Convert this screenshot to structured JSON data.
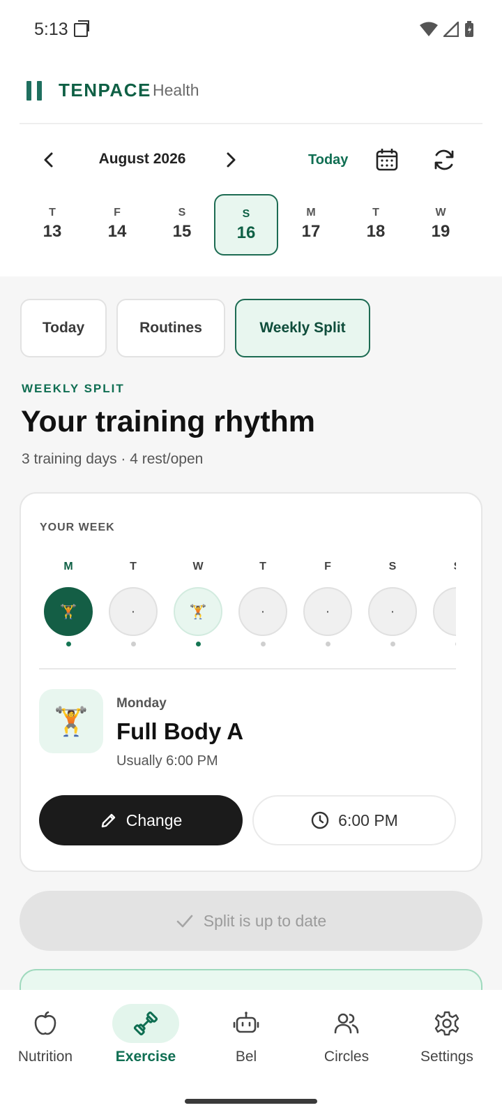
{
  "status_bar": {
    "time": "5:13"
  },
  "app": {
    "brand": "TENPACE",
    "brand_sub": "Health"
  },
  "calendar": {
    "month": "August 2026",
    "today_label": "Today",
    "days": [
      {
        "letter": "T",
        "num": "13"
      },
      {
        "letter": "F",
        "num": "14"
      },
      {
        "letter": "S",
        "num": "15"
      },
      {
        "letter": "S",
        "num": "16",
        "selected": true
      },
      {
        "letter": "M",
        "num": "17"
      },
      {
        "letter": "T",
        "num": "18"
      },
      {
        "letter": "W",
        "num": "19"
      }
    ]
  },
  "tabs": [
    {
      "label": "Today"
    },
    {
      "label": "Routines"
    },
    {
      "label": "Weekly Split",
      "active": true
    }
  ],
  "header": {
    "eyebrow": "WEEKLY SPLIT",
    "title": "Your training rhythm",
    "subtitle": "3 training days · 4 rest/open"
  },
  "week_card": {
    "label": "YOUR WEEK",
    "days": [
      {
        "letter": "M",
        "state": "selected-training",
        "content": "🏋️"
      },
      {
        "letter": "T",
        "state": "rest",
        "content": "·"
      },
      {
        "letter": "W",
        "state": "training",
        "content": "🏋️"
      },
      {
        "letter": "T",
        "state": "rest",
        "content": "·"
      },
      {
        "letter": "F",
        "state": "rest",
        "content": "·"
      },
      {
        "letter": "S",
        "state": "rest",
        "content": "·"
      },
      {
        "letter": "S",
        "state": "rest",
        "content": "·"
      }
    ],
    "routine": {
      "icon": "🏋️",
      "day": "Monday",
      "name": "Full Body A",
      "usual_time": "Usually 6:00 PM"
    },
    "change_label": "Change",
    "time_label": "6:00 PM"
  },
  "status_pill": "Split is up to date",
  "bottom_nav": [
    {
      "label": "Nutrition",
      "icon": "apple-icon"
    },
    {
      "label": "Exercise",
      "icon": "dumbbell-icon",
      "active": true
    },
    {
      "label": "Bel",
      "icon": "robot-icon"
    },
    {
      "label": "Circles",
      "icon": "people-icon"
    },
    {
      "label": "Settings",
      "icon": "gear-icon"
    }
  ],
  "colors": {
    "accent": "#0f6e52",
    "accent_bg": "#e8f6ef",
    "dark": "#1b1b1b"
  }
}
